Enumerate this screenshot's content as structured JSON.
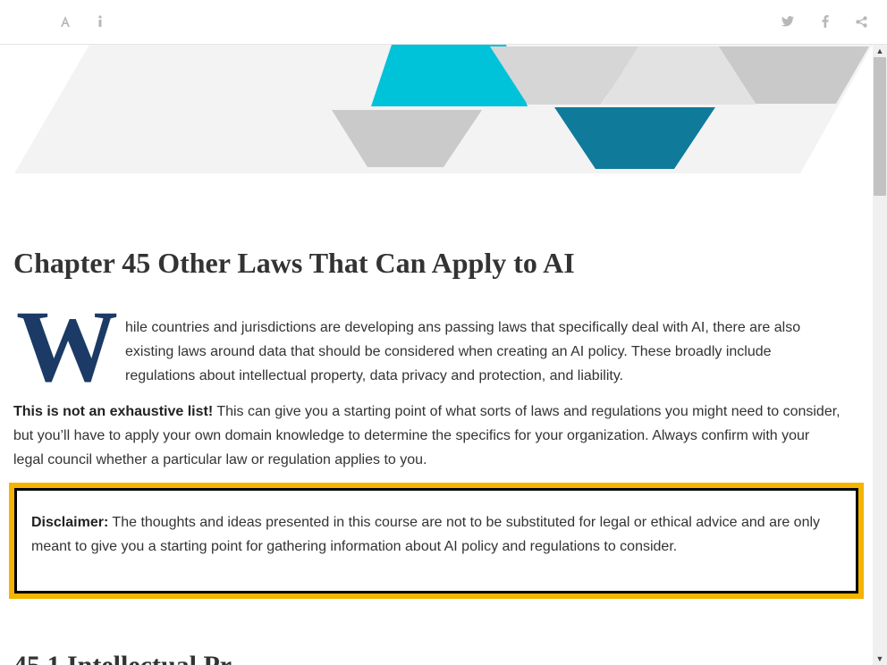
{
  "toolbar": {
    "left_icons": [
      "font-settings-icon",
      "info-icon"
    ],
    "right_icons": [
      "twitter-icon",
      "facebook-icon",
      "share-icon"
    ],
    "icon_color": "#b8b8b8"
  },
  "chapter": {
    "title": "Chapter 45   Other Laws That Can Apply to AI"
  },
  "intro": {
    "dropcap": "W",
    "text": "hile countries and jurisdictions are developing ans passing laws that specifically deal with AI, there are also existing laws around data that should be considered when creating an AI policy. These broadly include regulations about intellectual property, data privacy and protection, and liability."
  },
  "note": {
    "bold": "This is not an exhaustive list!",
    "text": " This can give you a starting point of what sorts of laws and regulations you might need to consider, but you’ll have to apply your own domain knowledge to determine the specifics for your organization. Always confirm with your legal council whether a particular law or regulation applies to you."
  },
  "disclaimer": {
    "label": "Disclaimer:",
    "text": " The thoughts and ideas presented in this course are not to be substituted for legal or ethical advice and are only meant to give you a starting point for gathering information about AI policy and regulations to consider.",
    "border_color": "#f4b400"
  },
  "next_section": {
    "title": "45.1   Intellectual Pr"
  },
  "colors": {
    "dropcap": "#1c3a66",
    "banner_cyan": "#00c2d9",
    "banner_teal": "#0f7a9a",
    "banner_gray": "#c9c9c9"
  }
}
